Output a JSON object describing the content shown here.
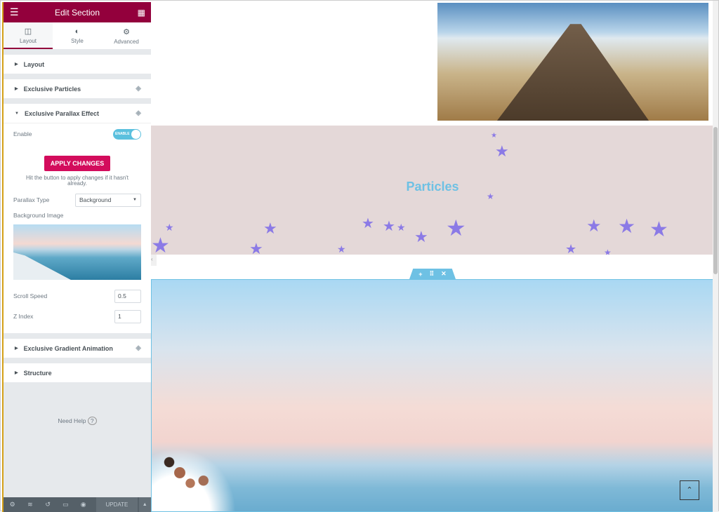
{
  "panel": {
    "title": "Edit Section",
    "menu_icon": "hamburger-icon",
    "grid_icon": "grid-icon",
    "tabs": [
      {
        "label": "Layout",
        "icon": "columns-icon"
      },
      {
        "label": "Style",
        "icon": "contrast-icon"
      },
      {
        "label": "Advanced",
        "icon": "gear-icon"
      }
    ],
    "sections": {
      "layout": "Layout",
      "particles": "Exclusive Particles",
      "parallax": "Exclusive Parallax Effect",
      "gradient": "Exclusive Gradient Animation",
      "structure": "Structure"
    },
    "parallax": {
      "enable_label": "Enable",
      "toggle_text": "ENABLE",
      "toggle_on": true,
      "apply_label": "APPLY CHANGES",
      "hint": "Hit the button to apply changes if it hasn't already.",
      "type_label": "Parallax Type",
      "type_value": "Background",
      "bg_label": "Background Image",
      "speed_label": "Scroll Speed",
      "speed_value": "0.5",
      "z_label": "Z Index",
      "z_value": "1"
    },
    "help": "Need Help",
    "footer": {
      "update": "UPDATE"
    }
  },
  "canvas": {
    "particles_heading": "Particles",
    "accent": "#6ec1e4",
    "star_color": "#8b7ae6",
    "primary": "#93003c"
  }
}
